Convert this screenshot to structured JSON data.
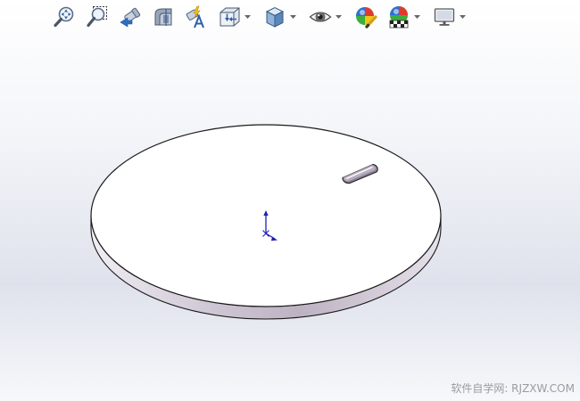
{
  "toolbar": {
    "items": [
      {
        "icon": "zoom-to-fit-icon",
        "dropdown": false
      },
      {
        "icon": "zoom-to-area-icon",
        "dropdown": false
      },
      {
        "icon": "previous-view-icon",
        "dropdown": false
      },
      {
        "icon": "section-view-icon",
        "dropdown": false
      },
      {
        "icon": "dynamic-annotation-views-icon",
        "dropdown": false
      },
      {
        "icon": "view-orientation-icon",
        "dropdown": true
      },
      {
        "icon": "display-style-icon",
        "dropdown": true
      },
      {
        "icon": "hide-show-items-icon",
        "dropdown": true
      },
      {
        "icon": "edit-appearance-icon",
        "dropdown": false
      },
      {
        "icon": "apply-scene-icon",
        "dropdown": true
      },
      {
        "icon": "view-settings-icon",
        "dropdown": true
      }
    ]
  },
  "model": {
    "part": "circular-plate-with-slot",
    "origin_axis_color": "#1f1fb4"
  },
  "colors": {
    "edge": "#1a1a1a",
    "plate_top": "#ffffff",
    "plate_side": "#c9c0cd"
  },
  "watermark": {
    "text": "软件自学网: RJZXW.COM"
  }
}
